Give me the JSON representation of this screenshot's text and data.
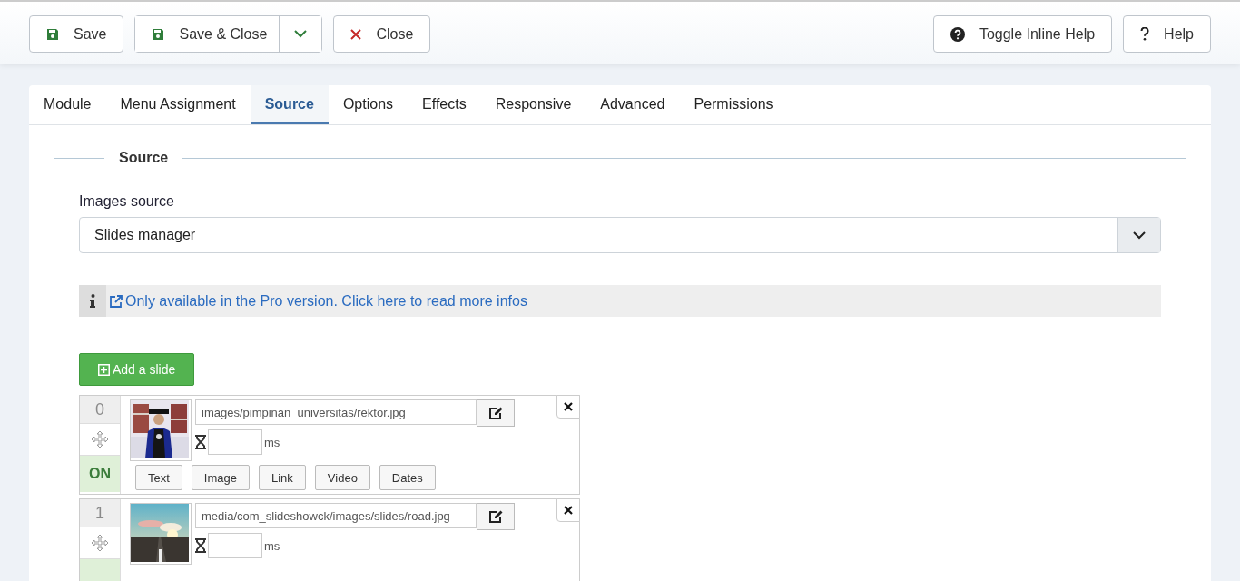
{
  "toolbar": {
    "left": [
      {
        "label": "Save",
        "kind": "save"
      },
      {
        "label": "Save & Close",
        "kind": "save-split"
      },
      {
        "label": "Close",
        "kind": "close"
      }
    ],
    "right": [
      {
        "label": "Toggle Inline Help",
        "kind": "help-circle"
      },
      {
        "label": "Help",
        "kind": "question"
      }
    ]
  },
  "tabs": [
    {
      "label": "Module",
      "selected": false
    },
    {
      "label": "Menu Assignment",
      "selected": false
    },
    {
      "label": "Source",
      "selected": true
    },
    {
      "label": "Options",
      "selected": false
    },
    {
      "label": "Effects",
      "selected": false
    },
    {
      "label": "Responsive",
      "selected": false
    },
    {
      "label": "Advanced",
      "selected": false
    },
    {
      "label": "Permissions",
      "selected": false
    }
  ],
  "source": {
    "legend": "Source",
    "images_source": {
      "label": "Images source",
      "value": "Slides manager"
    },
    "notice": "Only available in the Pro version. Click here to read more infos",
    "add_button": "Add a slide",
    "slides": [
      {
        "index": "0",
        "path": "images/pimpinan_universitas/rektor.jpg",
        "unit": "ms",
        "enabled": true,
        "state_label": "ON",
        "buttons": [
          "Text",
          "Image",
          "Link",
          "Video",
          "Dates"
        ]
      },
      {
        "index": "1",
        "path": "media/com_slideshowck/images/slides/road.jpg",
        "unit": "ms",
        "enabled": true
      }
    ]
  }
}
